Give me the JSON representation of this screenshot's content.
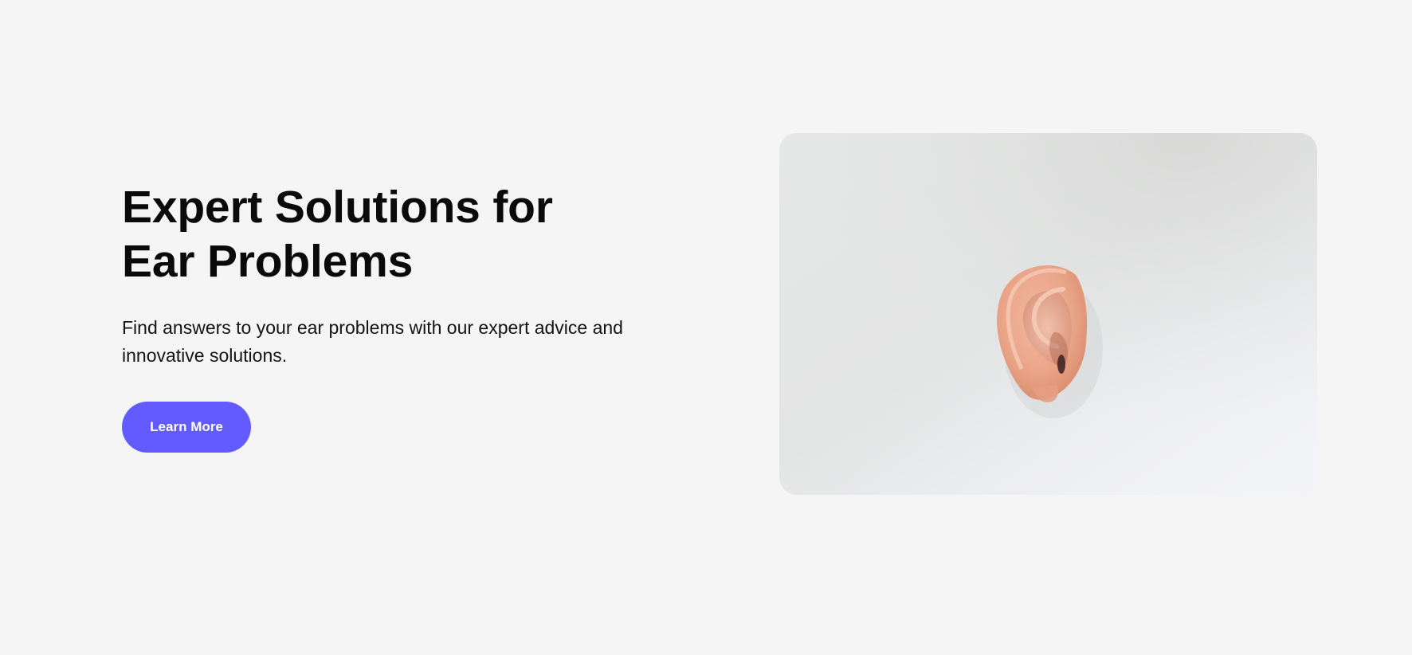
{
  "hero": {
    "title": "Expert Solutions for\nEar Problems",
    "subtitle": "Find answers to your ear problems with our expert advice and innovative solutions.",
    "cta_label": "Learn More",
    "image_subject": "ear-photo"
  },
  "colors": {
    "background": "#f5f5f5",
    "accent": "#635bff",
    "text": "#0a0a0a"
  }
}
